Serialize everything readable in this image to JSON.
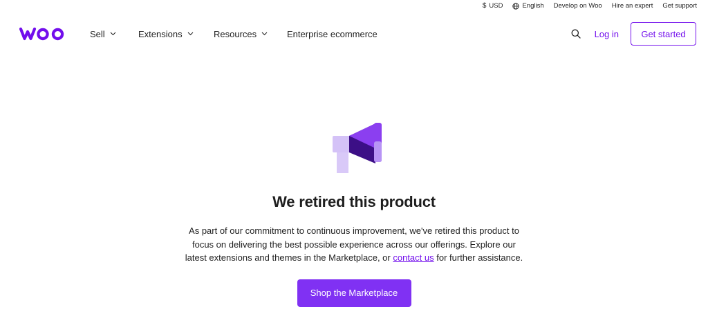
{
  "utility": {
    "currency": "USD",
    "language": "English",
    "develop": "Develop on Woo",
    "hire": "Hire an expert",
    "support": "Get support"
  },
  "nav": {
    "logo_text": "woo",
    "items": [
      {
        "label": "Sell",
        "has_dropdown": true
      },
      {
        "label": "Extensions",
        "has_dropdown": true
      },
      {
        "label": "Resources",
        "has_dropdown": true
      },
      {
        "label": "Enterprise ecommerce",
        "has_dropdown": false
      }
    ],
    "login": "Log in",
    "get_started": "Get started"
  },
  "hero": {
    "icon": "megaphone-icon",
    "title": "We retired this product",
    "text_before": "As part of our commitment to continuous improvement, we've retired this product to focus on delivering the best possible experience across our offerings. Explore our latest extensions and themes in the Marketplace, or ",
    "link_text": "contact us",
    "text_after": " for further assistance.",
    "button": "Shop the Marketplace"
  },
  "colors": {
    "brand": "#720eec",
    "button_bg": "#8031f3",
    "megaphone_light": "#d4c2f7",
    "megaphone_mid": "#8b3ff0",
    "megaphone_dark": "#3c0f86"
  }
}
